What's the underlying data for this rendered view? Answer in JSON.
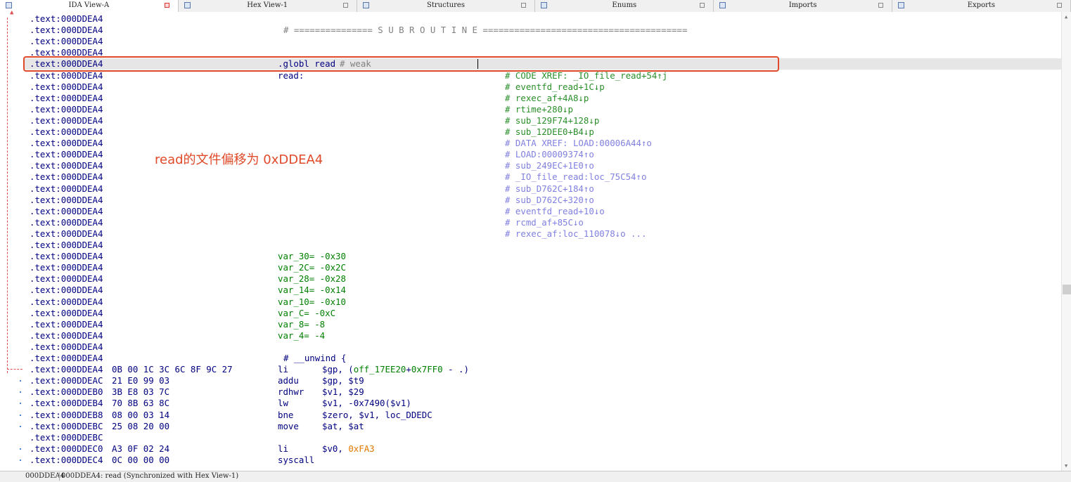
{
  "tabs": [
    {
      "label": "IDA View-A",
      "active": true
    },
    {
      "label": "Hex View-1",
      "active": false
    },
    {
      "label": "Structures",
      "active": false
    },
    {
      "label": "Enums",
      "active": false
    },
    {
      "label": "Imports",
      "active": false
    },
    {
      "label": "Exports",
      "active": false
    }
  ],
  "lines": [
    {
      "addr": ".text:000DDEA4"
    },
    {
      "addr": ".text:000DDEA4",
      "comment": "# =============== S U B R O U T I N E =======================================",
      "kind": "sub"
    },
    {
      "addr": ".text:000DDEA4"
    },
    {
      "addr": ".text:000DDEA4"
    },
    {
      "addr": ".text:000DDEA4",
      "label": ".globl read",
      "comment": "# weak",
      "kind": "globl",
      "selected": true
    },
    {
      "addr": ".text:000DDEA4",
      "label": "read:",
      "comment": "# CODE XREF: _IO_file_read+54↑j",
      "kind": "xref"
    },
    {
      "addr": ".text:000DDEA4",
      "comment": "# eventfd_read+1C↓p",
      "kind": "xref"
    },
    {
      "addr": ".text:000DDEA4",
      "comment": "# rexec_af+4A8↓p",
      "kind": "xref"
    },
    {
      "addr": ".text:000DDEA4",
      "comment": "# rtime+280↓p",
      "kind": "xref"
    },
    {
      "addr": ".text:000DDEA4",
      "comment": "# sub_129F74+128↓p",
      "kind": "xref"
    },
    {
      "addr": ".text:000DDEA4",
      "comment": "# sub_12DEE0+B4↓p",
      "kind": "xref"
    },
    {
      "addr": ".text:000DDEA4",
      "comment": "# DATA XREF: LOAD:00006A44↑o",
      "kind": "data"
    },
    {
      "addr": ".text:000DDEA4",
      "comment": "# LOAD:00009374↑o",
      "kind": "data"
    },
    {
      "addr": ".text:000DDEA4",
      "comment": "# sub_249EC+1E0↑o",
      "kind": "data"
    },
    {
      "addr": ".text:000DDEA4",
      "comment": "# _IO_file_read:loc_75C54↑o",
      "kind": "data"
    },
    {
      "addr": ".text:000DDEA4",
      "comment": "# sub_D762C+184↑o",
      "kind": "data"
    },
    {
      "addr": ".text:000DDEA4",
      "comment": "# sub_D762C+320↑o",
      "kind": "data"
    },
    {
      "addr": ".text:000DDEA4",
      "comment": "# eventfd_read+10↓o",
      "kind": "data"
    },
    {
      "addr": ".text:000DDEA4",
      "comment": "# rcmd_af+85C↓o",
      "kind": "data"
    },
    {
      "addr": ".text:000DDEA4",
      "comment": "# rexec_af:loc_110078↓o ...",
      "kind": "data"
    },
    {
      "addr": ".text:000DDEA4"
    },
    {
      "addr": ".text:000DDEA4",
      "var": "var_30= -0x30"
    },
    {
      "addr": ".text:000DDEA4",
      "var": "var_2C= -0x2C"
    },
    {
      "addr": ".text:000DDEA4",
      "var": "var_28= -0x28"
    },
    {
      "addr": ".text:000DDEA4",
      "var": "var_14= -0x14"
    },
    {
      "addr": ".text:000DDEA4",
      "var": "var_10= -0x10"
    },
    {
      "addr": ".text:000DDEA4",
      "var": "var_C= -0xC"
    },
    {
      "addr": ".text:000DDEA4",
      "var": "var_8= -8"
    },
    {
      "addr": ".text:000DDEA4",
      "var": "var_4= -4"
    },
    {
      "addr": ".text:000DDEA4"
    },
    {
      "addr": ".text:000DDEA4",
      "unwind": "# __unwind {"
    },
    {
      "addr": ".text:000DDEA4",
      "bytes": "0B 00 1C 3C 6C 8F 9C 27",
      "mnem": "li",
      "ops": [
        {
          "t": "$gp, (",
          "c": ""
        },
        {
          "t": "off_17EE20",
          "c": "g"
        },
        {
          "t": "+",
          "c": ""
        },
        {
          "t": "0x7FF0",
          "c": "g"
        },
        {
          "t": " - .)",
          "c": ""
        }
      ]
    },
    {
      "addr": ".text:000DDEAC",
      "bytes": "21 E0 99 03",
      "mnem": "addu",
      "ops": [
        {
          "t": "$gp, $t9",
          "c": ""
        }
      ]
    },
    {
      "addr": ".text:000DDEB0",
      "bytes": "3B E8 03 7C",
      "mnem": "rdhwr",
      "ops": [
        {
          "t": "$v1, $29",
          "c": ""
        }
      ]
    },
    {
      "addr": ".text:000DDEB4",
      "bytes": "70 8B 63 8C",
      "mnem": "lw",
      "ops": [
        {
          "t": "$v1, -0x7490($v1)",
          "c": ""
        }
      ]
    },
    {
      "addr": ".text:000DDEB8",
      "bytes": "08 00 03 14",
      "mnem": "bne",
      "ops": [
        {
          "t": "$zero, $v1, loc_DDEDC",
          "c": ""
        }
      ]
    },
    {
      "addr": ".text:000DDEBC",
      "bytes": "25 08 20 00",
      "mnem": "move",
      "ops": [
        {
          "t": "$at, $at",
          "c": ""
        }
      ]
    },
    {
      "addr": ".text:000DDEBC"
    },
    {
      "addr": ".text:000DDEC0",
      "bytes": "A3 0F 02 24",
      "mnem": "li",
      "ops": [
        {
          "t": "$v0, ",
          "c": ""
        },
        {
          "t": "0xFA3",
          "c": "o"
        }
      ]
    },
    {
      "addr": ".text:000DDEC4",
      "bytes": "0C 00 00 00",
      "mnem": "syscall",
      "ops": []
    }
  ],
  "annotation": "read的文件偏移为 0xDDEA4",
  "status": {
    "address": "000DDEA4",
    "message": "000DDEA4: read (Synchronized with Hex View-1)"
  }
}
